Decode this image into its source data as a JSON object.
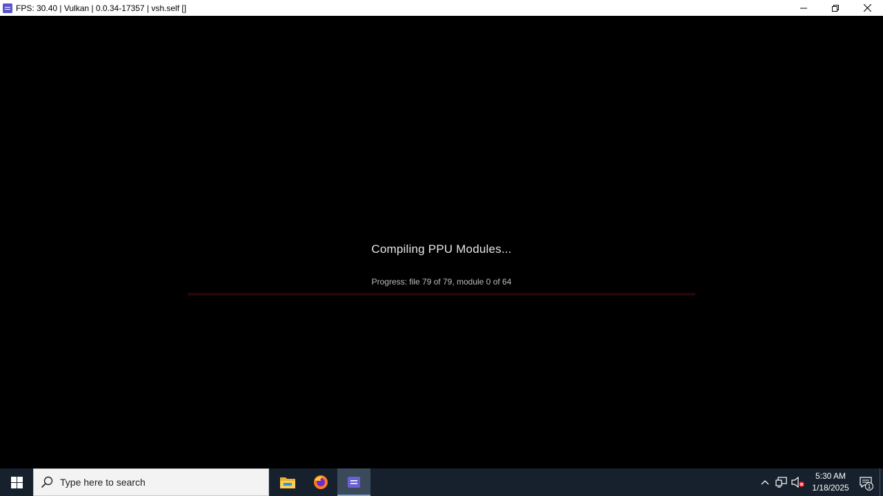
{
  "window": {
    "title": "FPS: 30.40 | Vulkan | 0.0.34-17357 | vsh.self []",
    "controls": [
      "minimize-icon",
      "restore-icon",
      "close-icon"
    ]
  },
  "content": {
    "heading": "Compiling PPU Modules...",
    "progress_text": "Progress: file 79 of 79, module 0 of 64",
    "progress_fraction": 0.0,
    "colors": {
      "track": "#2a0508",
      "fill": "#7a0a14",
      "background": "#000000"
    }
  },
  "taskbar": {
    "search_placeholder": "Type here to search",
    "apps": [
      {
        "name": "file-explorer-icon"
      },
      {
        "name": "firefox-icon"
      },
      {
        "name": "rpcs3-icon",
        "active": true
      }
    ],
    "tray": {
      "icons": [
        "chevron-up-icon",
        "network-icon",
        "volume-muted-icon"
      ],
      "time": "5:30 AM",
      "date": "1/18/2025",
      "notification_count": "1"
    }
  }
}
